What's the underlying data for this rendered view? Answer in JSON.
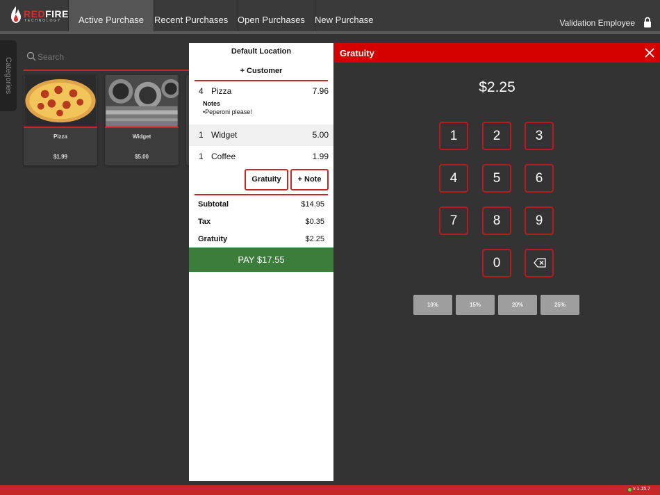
{
  "brand": {
    "name_red": "RED",
    "name_white": "FIRE",
    "tagline": "TECHNOLOGY"
  },
  "nav": {
    "tabs": [
      {
        "label": "Active Purchase"
      },
      {
        "label": "Recent Purchases"
      },
      {
        "label": "Open Purchases"
      },
      {
        "label": "New Purchase"
      }
    ],
    "user": "Validation Employee"
  },
  "sidebar": {
    "categories_label": "Categories"
  },
  "search": {
    "placeholder": "Search"
  },
  "products": [
    {
      "name": "Pizza",
      "price": "$1.99"
    },
    {
      "name": "Widget",
      "price": "$5.00"
    }
  ],
  "order": {
    "location": "Default Location",
    "add_customer": "+ Customer",
    "items": [
      {
        "qty": "4",
        "name": "Pizza",
        "amount": "7.96"
      },
      {
        "qty": "1",
        "name": "Widget",
        "amount": "5.00"
      },
      {
        "qty": "1",
        "name": "Coffee",
        "amount": "1.99"
      }
    ],
    "notes_label": "Notes",
    "notes_text": "•Peperoni please!",
    "gratuity_button": "Gratuity",
    "note_button": "+ Note",
    "totals": {
      "subtotal_label": "Subtotal",
      "subtotal": "$14.95",
      "tax_label": "Tax",
      "tax": "$0.35",
      "gratuity_label": "Gratuity",
      "gratuity": "$2.25"
    },
    "pay_button": "PAY $17.55"
  },
  "gratuity_modal": {
    "title": "Gratuity",
    "amount": "$2.25",
    "keys": [
      "1",
      "2",
      "3",
      "4",
      "5",
      "6",
      "7",
      "8",
      "9",
      "0"
    ],
    "percent_buttons": [
      "10%",
      "15%",
      "20%",
      "25%"
    ]
  },
  "footer": {
    "version": "v 1.15.7"
  },
  "colors": {
    "accent": "#d50000",
    "pay": "#3c7d3c",
    "background": "#333333"
  }
}
